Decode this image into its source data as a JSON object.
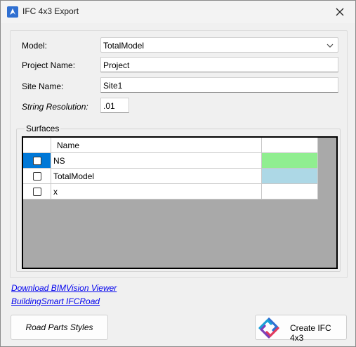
{
  "window": {
    "title": "IFC 4x3 Export",
    "icons": {
      "app": "bricscad-app-icon",
      "close": "close-icon"
    }
  },
  "form": {
    "model_label": "Model:",
    "model_value": "TotalModel",
    "project_label": "Project Name:",
    "project_value": "Project",
    "site_label": "Site Name:",
    "site_value": "Site1",
    "resolution_label": "String Resolution:",
    "resolution_value": ".01"
  },
  "surfaces": {
    "title": "Surfaces",
    "header": {
      "name": "Name"
    },
    "rows": [
      {
        "name": "NS",
        "checked": false,
        "color": "#90ee90",
        "selected": true
      },
      {
        "name": "TotalModel",
        "checked": false,
        "color": "#add8e6",
        "selected": false
      },
      {
        "name": "x",
        "checked": false,
        "color": "#ffffff",
        "selected": false
      }
    ]
  },
  "links": {
    "bimvision": "Download BIMVision Viewer",
    "ifcroad": "BuildingSmart IFCRoad"
  },
  "buttons": {
    "road_parts": "Road Parts Styles",
    "create": "Create IFC 4x3",
    "create_icon": "ifc-logo-icon"
  }
}
